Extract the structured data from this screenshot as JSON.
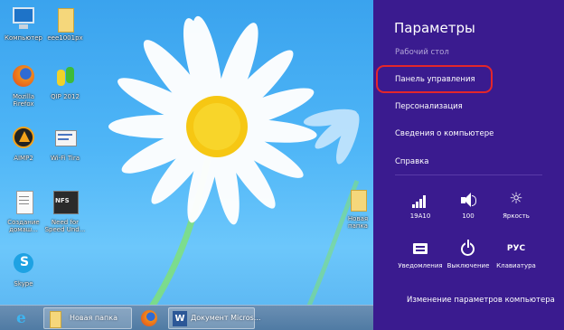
{
  "desktop": {
    "icons": [
      {
        "label": "Компьютер",
        "icon": "computer-icon"
      },
      {
        "label": "eee1001px",
        "icon": "folder-icon"
      },
      {
        "label": "Mozilla\nFirefox",
        "icon": "firefox-icon"
      },
      {
        "label": "QIP 2012",
        "icon": "qip-icon"
      },
      {
        "label": "AIMP2",
        "icon": "aimp-icon"
      },
      {
        "label": "Wi-Fi Tira",
        "icon": "wifi-tool-icon"
      },
      {
        "label": "Создание\nдомаш...",
        "icon": "document-icon"
      },
      {
        "label": "Need for\nSpeed Und...",
        "icon": "nfs-icon"
      },
      {
        "label": "Skype",
        "icon": "skype-icon"
      },
      {
        "label": "Новая папка",
        "icon": "folder-icon"
      }
    ]
  },
  "taskbar": {
    "items": [
      {
        "label": "",
        "icon": "ie-icon"
      },
      {
        "label": "Новая папка",
        "icon": "folder-icon"
      },
      {
        "label": "",
        "icon": "firefox-icon"
      },
      {
        "label": "Документ Micros...",
        "icon": "word-icon"
      }
    ]
  },
  "charm": {
    "title": "Параметры",
    "subtitle": "Рабочий стол",
    "items": [
      "Панель управления",
      "Персонализация",
      "Сведения о компьютере",
      "Справка"
    ],
    "highlight_color": "#e4262b",
    "quick_settings": [
      {
        "label": "19A10",
        "icon": "network-signal-icon"
      },
      {
        "label": "100",
        "icon": "volume-icon"
      },
      {
        "label": "Яркость",
        "icon": "brightness-icon"
      },
      {
        "label": "Уведомления",
        "icon": "notifications-icon"
      },
      {
        "label": "Выключение",
        "icon": "power-icon"
      },
      {
        "label": "Клавиатура",
        "icon": "keyboard-icon",
        "glyph": "РУС"
      }
    ],
    "footer": "Изменение параметров компьютера"
  },
  "colors": {
    "charm_bg": "#3a1b8f",
    "desktop_sky": "#4fb6f7"
  }
}
